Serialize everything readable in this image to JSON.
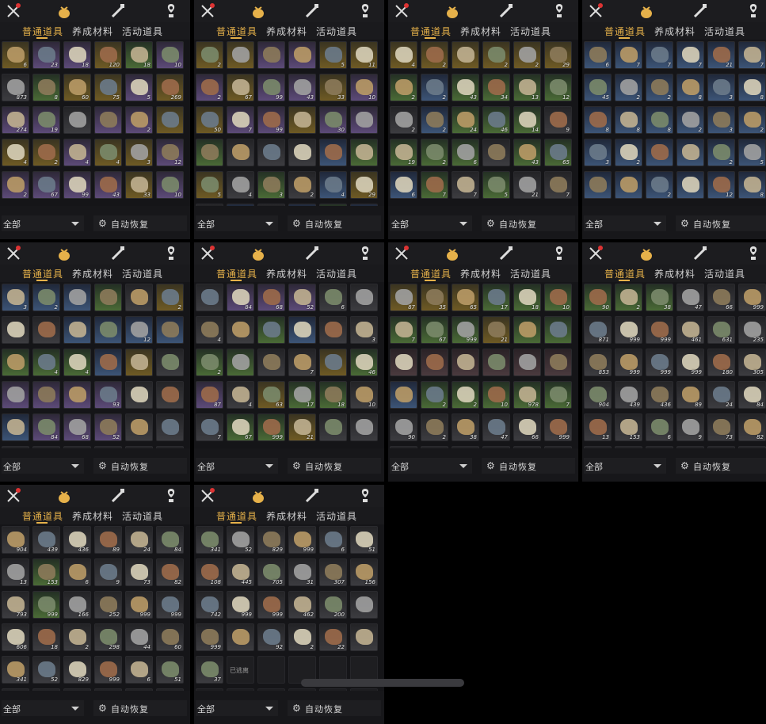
{
  "tabs": {
    "normal": "普通道具",
    "raising": "养成材料",
    "event": "活动道具"
  },
  "filter": {
    "label": "全部"
  },
  "auto": {
    "label": "自动恢复"
  },
  "colors": {
    "accent": "#e6b14a",
    "bg": "#17171a"
  },
  "icons": [
    "crossed-swords-pin-icon",
    "money-bag-icon",
    "spyglass-icon",
    "pin-marker-icon"
  ],
  "panels": [
    {
      "slots": [
        [
          "gold",
          "6"
        ],
        [
          "purple",
          "23"
        ],
        [
          "purple",
          "18"
        ],
        [
          "gold",
          "120"
        ],
        [
          "green",
          "18"
        ],
        [
          "purple",
          "10"
        ],
        [
          "gray",
          "873"
        ],
        [
          "green",
          "8"
        ],
        [
          "gold",
          "60"
        ],
        [
          "gold",
          "75"
        ],
        [
          "purple",
          "5"
        ],
        [
          "gold",
          "269"
        ],
        [
          "purple",
          "274"
        ],
        [
          "purple",
          "19"
        ],
        [
          "gray",
          ""
        ],
        [
          "purple",
          ""
        ],
        [
          "purple",
          "2"
        ],
        [
          "gold",
          ""
        ],
        [
          "gold",
          "4"
        ],
        [
          "gold",
          "2"
        ],
        [
          "purple",
          "4"
        ],
        [
          "gold",
          "4"
        ],
        [
          "gold",
          "3"
        ],
        [
          "purple",
          "12"
        ],
        [
          "purple",
          "2"
        ],
        [
          "purple",
          "67"
        ],
        [
          "purple",
          "99"
        ],
        [
          "purple",
          "43"
        ],
        [
          "gold",
          "33"
        ],
        [
          "purple",
          "10"
        ]
      ]
    },
    {
      "slots": [
        [
          "gold",
          "2"
        ],
        [
          "gold",
          ""
        ],
        [
          "purple",
          ""
        ],
        [
          "purple",
          ""
        ],
        [
          "gold",
          "5"
        ],
        [
          "gold",
          "11"
        ],
        [
          "purple",
          "2"
        ],
        [
          "gold",
          "67"
        ],
        [
          "purple",
          "99"
        ],
        [
          "purple",
          "43"
        ],
        [
          "gold",
          "33"
        ],
        [
          "purple",
          "10"
        ],
        [
          "gold",
          "50"
        ],
        [
          "purple",
          "7"
        ],
        [
          "purple",
          "99"
        ],
        [
          "gold",
          ""
        ],
        [
          "purple",
          "30"
        ],
        [
          "purple",
          ""
        ],
        [
          "green",
          ""
        ],
        [
          "gray",
          ""
        ],
        [
          "gray",
          ""
        ],
        [
          "gray",
          ""
        ],
        [
          "blue",
          ""
        ],
        [
          "green",
          ""
        ],
        [
          "gold",
          "5"
        ],
        [
          "gray",
          "4"
        ],
        [
          "green",
          "3"
        ],
        [
          "gray",
          "2"
        ],
        [
          "blue",
          "4"
        ],
        [
          "gold",
          "29"
        ],
        [
          "gray",
          "2"
        ],
        [
          "blue",
          "2"
        ],
        [
          "gray",
          "2"
        ],
        [
          "blue",
          "43"
        ],
        [
          "green",
          "34"
        ],
        [
          "blue",
          "13"
        ]
      ]
    },
    {
      "slots": [
        [
          "gold",
          "4"
        ],
        [
          "gold",
          "2"
        ],
        [
          "gold",
          ""
        ],
        [
          "gold",
          "2"
        ],
        [
          "gold",
          "2"
        ],
        [
          "gold",
          "29"
        ],
        [
          "green",
          "2"
        ],
        [
          "blue",
          "2"
        ],
        [
          "green",
          "43"
        ],
        [
          "green",
          "34"
        ],
        [
          "green",
          "13"
        ],
        [
          "green",
          "12"
        ],
        [
          "gray",
          "2"
        ],
        [
          "blue",
          "2"
        ],
        [
          "green",
          "24"
        ],
        [
          "green",
          "46"
        ],
        [
          "green",
          "14"
        ],
        [
          "gray",
          "9"
        ],
        [
          "green",
          "19"
        ],
        [
          "green",
          "2"
        ],
        [
          "green",
          "6"
        ],
        [
          "gray",
          ""
        ],
        [
          "green",
          "43"
        ],
        [
          "green",
          "65"
        ],
        [
          "blue",
          "6"
        ],
        [
          "green",
          "7"
        ],
        [
          "gray",
          "7"
        ],
        [
          "green",
          "5"
        ],
        [
          "gray",
          "21"
        ],
        [
          "gray",
          "7"
        ]
      ]
    },
    {
      "slots": [
        [
          "blue",
          "6"
        ],
        [
          "blue",
          "7"
        ],
        [
          "blue",
          "7"
        ],
        [
          "blue",
          "7"
        ],
        [
          "blue",
          "21"
        ],
        [
          "blue",
          "7"
        ],
        [
          "blue",
          "45"
        ],
        [
          "blue",
          "2"
        ],
        [
          "blue",
          "2"
        ],
        [
          "blue",
          "8"
        ],
        [
          "blue",
          "3"
        ],
        [
          "blue",
          "8"
        ],
        [
          "blue",
          "8"
        ],
        [
          "blue",
          "8"
        ],
        [
          "blue",
          "8"
        ],
        [
          "blue",
          "2"
        ],
        [
          "blue",
          "3"
        ],
        [
          "blue",
          "2"
        ],
        [
          "blue",
          "3"
        ],
        [
          "blue",
          "2"
        ],
        [
          "blue",
          ""
        ],
        [
          "blue",
          ""
        ],
        [
          "blue",
          "2"
        ],
        [
          "blue",
          "5"
        ],
        [
          "blue",
          ""
        ],
        [
          "blue",
          ""
        ],
        [
          "blue",
          "2"
        ],
        [
          "blue",
          ""
        ],
        [
          "blue",
          "12"
        ],
        [
          "blue",
          "8"
        ]
      ]
    },
    {
      "slots": [
        [
          "blue",
          "3"
        ],
        [
          "blue",
          "2"
        ],
        [
          "blue",
          ""
        ],
        [
          "green",
          ""
        ],
        [
          "gray",
          ""
        ],
        [
          "gold",
          "2"
        ],
        [
          "gray",
          ""
        ],
        [
          "gray",
          ""
        ],
        [
          "blue",
          ""
        ],
        [
          "blue",
          ""
        ],
        [
          "blue",
          "12"
        ],
        [
          "blue",
          ""
        ],
        [
          "green",
          ""
        ],
        [
          "green",
          "4"
        ],
        [
          "green",
          "4"
        ],
        [
          "blue",
          ""
        ],
        [
          "gold",
          ""
        ],
        [
          "gray",
          ""
        ],
        [
          "purple",
          ""
        ],
        [
          "purple",
          ""
        ],
        [
          "purple",
          ""
        ],
        [
          "purple",
          "93"
        ],
        [
          "gray",
          ""
        ],
        [
          "gray",
          ""
        ],
        [
          "blue",
          ""
        ],
        [
          "purple",
          "84"
        ],
        [
          "purple",
          "68"
        ],
        [
          "purple",
          "52"
        ],
        [
          "gray",
          ""
        ],
        [
          "gray",
          ""
        ],
        [
          "gray",
          ""
        ],
        [
          "gray",
          ""
        ],
        [
          "gray",
          ""
        ],
        [
          "gray",
          ""
        ],
        [
          "gray",
          ""
        ],
        [
          "gray",
          ""
        ]
      ]
    },
    {
      "slots": [
        [
          "gray",
          ""
        ],
        [
          "purple",
          "84"
        ],
        [
          "purple",
          "68"
        ],
        [
          "purple",
          "52"
        ],
        [
          "gray",
          "6"
        ],
        [
          "gray",
          ""
        ],
        [
          "gray",
          "4"
        ],
        [
          "gray",
          ""
        ],
        [
          "green",
          ""
        ],
        [
          "blue",
          ""
        ],
        [
          "gray",
          ""
        ],
        [
          "gray",
          "3"
        ],
        [
          "green",
          "2"
        ],
        [
          "green",
          ""
        ],
        [
          "gray",
          ""
        ],
        [
          "gray",
          "7"
        ],
        [
          "gold",
          ""
        ],
        [
          "green",
          "46"
        ],
        [
          "purple",
          "87"
        ],
        [
          "gray",
          "4"
        ],
        [
          "gold",
          "63"
        ],
        [
          "green",
          "17"
        ],
        [
          "green",
          "18"
        ],
        [
          "gray",
          "10"
        ],
        [
          "gray",
          "7"
        ],
        [
          "green",
          "67"
        ],
        [
          "green",
          "999"
        ],
        [
          "gold",
          "21"
        ],
        [
          "gray",
          ""
        ],
        [
          "gray",
          ""
        ]
      ]
    },
    {
      "slots": [
        [
          "gold",
          "87"
        ],
        [
          "gold",
          "35"
        ],
        [
          "gold",
          "65"
        ],
        [
          "green",
          "17"
        ],
        [
          "green",
          "18"
        ],
        [
          "green",
          "10"
        ],
        [
          "green",
          "7"
        ],
        [
          "green",
          "67"
        ],
        [
          "green",
          "999"
        ],
        [
          "gold",
          "21"
        ],
        [
          "green",
          ""
        ],
        [
          "green",
          ""
        ],
        [
          "red",
          ""
        ],
        [
          "red",
          ""
        ],
        [
          "red",
          ""
        ],
        [
          "red",
          ""
        ],
        [
          "red",
          ""
        ],
        [
          "red",
          ""
        ],
        [
          "blue",
          ""
        ],
        [
          "green",
          "2"
        ],
        [
          "green",
          "2"
        ],
        [
          "green",
          "10"
        ],
        [
          "green",
          "978"
        ],
        [
          "green",
          "7"
        ],
        [
          "gray",
          "90"
        ],
        [
          "gray",
          "2"
        ],
        [
          "gray",
          "38"
        ],
        [
          "gray",
          "47"
        ],
        [
          "gray",
          "66"
        ],
        [
          "gray",
          "999"
        ],
        [
          "gray",
          ""
        ],
        [
          "gray",
          ""
        ],
        [
          "gray",
          ""
        ],
        [
          "gray",
          ""
        ],
        [
          "gray",
          ""
        ],
        [
          "gray",
          ""
        ]
      ]
    },
    {
      "slots": [
        [
          "green",
          "90"
        ],
        [
          "green",
          "2"
        ],
        [
          "green",
          "38"
        ],
        [
          "gray",
          "47"
        ],
        [
          "gray",
          "66"
        ],
        [
          "gray",
          "999"
        ],
        [
          "gray",
          "871"
        ],
        [
          "gray",
          "999"
        ],
        [
          "gray",
          "999"
        ],
        [
          "gray",
          "461"
        ],
        [
          "gray",
          "631"
        ],
        [
          "gray",
          "235"
        ],
        [
          "gray",
          "853"
        ],
        [
          "gray",
          "999"
        ],
        [
          "gray",
          "999"
        ],
        [
          "gray",
          "999"
        ],
        [
          "gray",
          "180"
        ],
        [
          "gray",
          "305"
        ],
        [
          "gray",
          "904"
        ],
        [
          "gray",
          "439"
        ],
        [
          "gray",
          "436"
        ],
        [
          "gray",
          "89"
        ],
        [
          "gray",
          "24"
        ],
        [
          "gray",
          "84"
        ],
        [
          "gray",
          "13"
        ],
        [
          "gray",
          "153"
        ],
        [
          "gray",
          "6"
        ],
        [
          "gray",
          "9"
        ],
        [
          "gray",
          "73"
        ],
        [
          "gray",
          "82"
        ],
        [
          "gray",
          ""
        ],
        [
          "gray",
          ""
        ],
        [
          "gray",
          ""
        ],
        [
          "gray",
          ""
        ],
        [
          "gray",
          ""
        ],
        [
          "gray",
          ""
        ]
      ]
    },
    {
      "slots": [
        [
          "gray",
          "904"
        ],
        [
          "gray",
          "439"
        ],
        [
          "gray",
          "436"
        ],
        [
          "gray",
          "89"
        ],
        [
          "gray",
          "24"
        ],
        [
          "gray",
          "84"
        ],
        [
          "gray",
          "13"
        ],
        [
          "green",
          "153"
        ],
        [
          "gray",
          "6"
        ],
        [
          "gray",
          "9"
        ],
        [
          "gray",
          "73"
        ],
        [
          "gray",
          "82"
        ],
        [
          "gray",
          "793"
        ],
        [
          "green",
          "999"
        ],
        [
          "gray",
          "166"
        ],
        [
          "gray",
          "252"
        ],
        [
          "gray",
          "999"
        ],
        [
          "gray",
          "999"
        ],
        [
          "gray",
          "606"
        ],
        [
          "gray",
          "18"
        ],
        [
          "gray",
          "2"
        ],
        [
          "gray",
          "298"
        ],
        [
          "gray",
          "44"
        ],
        [
          "gray",
          "60"
        ],
        [
          "gray",
          "341"
        ],
        [
          "gray",
          "52"
        ],
        [
          "gray",
          "829"
        ],
        [
          "gray",
          "999"
        ],
        [
          "gray",
          "6"
        ],
        [
          "gray",
          "51"
        ],
        [
          "gray",
          ""
        ],
        [
          "gray",
          ""
        ],
        [
          "gray",
          ""
        ],
        [
          "gray",
          ""
        ],
        [
          "gray",
          ""
        ],
        [
          "gray",
          ""
        ]
      ]
    },
    {
      "slots": [
        [
          "gray",
          "341"
        ],
        [
          "gray",
          "52"
        ],
        [
          "gray",
          "829"
        ],
        [
          "gray",
          "999"
        ],
        [
          "gray",
          "6"
        ],
        [
          "gray",
          "51"
        ],
        [
          "gray",
          "108"
        ],
        [
          "gray",
          "445"
        ],
        [
          "gray",
          "705"
        ],
        [
          "gray",
          "31"
        ],
        [
          "gray",
          "307"
        ],
        [
          "gray",
          "156"
        ],
        [
          "gray",
          "742"
        ],
        [
          "gray",
          "999"
        ],
        [
          "gray",
          "999"
        ],
        [
          "gray",
          "462"
        ],
        [
          "gray",
          "200"
        ],
        [
          "gray",
          ""
        ],
        [
          "gray",
          "999"
        ],
        [
          "gray",
          ""
        ],
        [
          "gray",
          "92"
        ],
        [
          "gray",
          "2"
        ],
        [
          "gray",
          "22"
        ],
        [
          "gray",
          ""
        ],
        [
          "gray",
          "37"
        ],
        [
          "empty",
          "已逃离"
        ],
        [
          "empty",
          ""
        ],
        [
          "empty",
          ""
        ],
        [
          "empty",
          ""
        ],
        [
          "empty",
          ""
        ],
        [
          "empty",
          ""
        ],
        [
          "empty",
          ""
        ],
        [
          "empty",
          ""
        ],
        [
          "empty",
          ""
        ],
        [
          "empty",
          ""
        ],
        [
          "empty",
          ""
        ]
      ]
    }
  ]
}
